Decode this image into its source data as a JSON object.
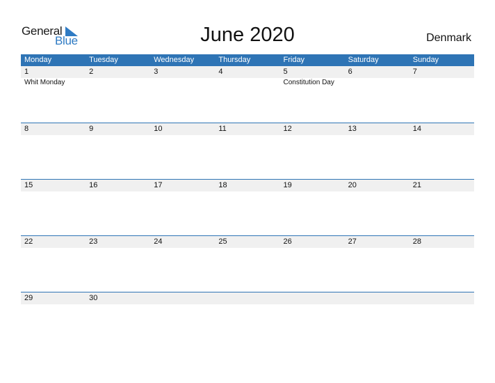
{
  "logo": {
    "line1": "General",
    "line2": "Blue"
  },
  "title": "June 2020",
  "country": "Denmark",
  "colors": {
    "accent": "#2e74b5",
    "strip": "#f0f0f0"
  },
  "weekdays": [
    "Monday",
    "Tuesday",
    "Wednesday",
    "Thursday",
    "Friday",
    "Saturday",
    "Sunday"
  ],
  "weeks": [
    {
      "days": [
        "1",
        "2",
        "3",
        "4",
        "5",
        "6",
        "7"
      ],
      "events": [
        "Whit Monday",
        "",
        "",
        "",
        "Constitution Day",
        "",
        ""
      ]
    },
    {
      "days": [
        "8",
        "9",
        "10",
        "11",
        "12",
        "13",
        "14"
      ],
      "events": [
        "",
        "",
        "",
        "",
        "",
        "",
        ""
      ]
    },
    {
      "days": [
        "15",
        "16",
        "17",
        "18",
        "19",
        "20",
        "21"
      ],
      "events": [
        "",
        "",
        "",
        "",
        "",
        "",
        ""
      ]
    },
    {
      "days": [
        "22",
        "23",
        "24",
        "25",
        "26",
        "27",
        "28"
      ],
      "events": [
        "",
        "",
        "",
        "",
        "",
        "",
        ""
      ]
    },
    {
      "days": [
        "29",
        "30",
        "",
        "",
        "",
        "",
        ""
      ],
      "events": [
        "",
        "",
        "",
        "",
        "",
        "",
        ""
      ]
    }
  ]
}
